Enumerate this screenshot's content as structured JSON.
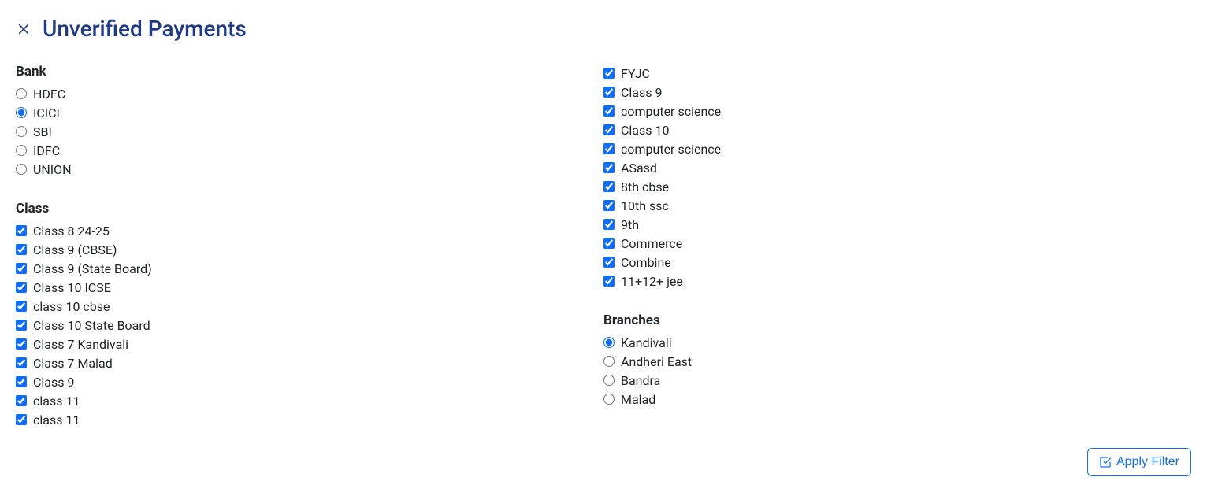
{
  "header": {
    "title": "Unverified Payments"
  },
  "bank": {
    "heading": "Bank",
    "options": [
      {
        "label": "HDFC",
        "selected": false
      },
      {
        "label": "ICICI",
        "selected": true
      },
      {
        "label": "SBI",
        "selected": false
      },
      {
        "label": "IDFC",
        "selected": false
      },
      {
        "label": "UNION",
        "selected": false
      }
    ]
  },
  "class": {
    "heading": "Class",
    "left": [
      {
        "label": "Class 8 24-25",
        "checked": true
      },
      {
        "label": "Class 9 (CBSE)",
        "checked": true
      },
      {
        "label": "Class 9 (State Board)",
        "checked": true
      },
      {
        "label": "Class 10 ICSE",
        "checked": true
      },
      {
        "label": "class 10 cbse",
        "checked": true
      },
      {
        "label": "Class 10 State Board",
        "checked": true
      },
      {
        "label": "Class 7 Kandivali",
        "checked": true
      },
      {
        "label": "Class 7 Malad",
        "checked": true
      },
      {
        "label": "Class 9",
        "checked": true
      },
      {
        "label": "class 11",
        "checked": true
      },
      {
        "label": "class 11",
        "checked": true
      }
    ],
    "right": [
      {
        "label": "FYJC",
        "checked": true
      },
      {
        "label": "Class 9",
        "checked": true
      },
      {
        "label": "computer science",
        "checked": true
      },
      {
        "label": "Class 10",
        "checked": true
      },
      {
        "label": "computer science",
        "checked": true
      },
      {
        "label": "ASasd",
        "checked": true
      },
      {
        "label": "8th cbse",
        "checked": true
      },
      {
        "label": "10th ssc",
        "checked": true
      },
      {
        "label": "9th",
        "checked": true
      },
      {
        "label": "Commerce",
        "checked": true
      },
      {
        "label": "Combine",
        "checked": true
      },
      {
        "label": "11+12+ jee",
        "checked": true
      }
    ]
  },
  "branches": {
    "heading": "Branches",
    "options": [
      {
        "label": "Kandivali",
        "selected": true
      },
      {
        "label": "Andheri East",
        "selected": false
      },
      {
        "label": "Bandra",
        "selected": false
      },
      {
        "label": "Malad",
        "selected": false
      }
    ]
  },
  "footer": {
    "apply_label": "Apply Filter"
  }
}
